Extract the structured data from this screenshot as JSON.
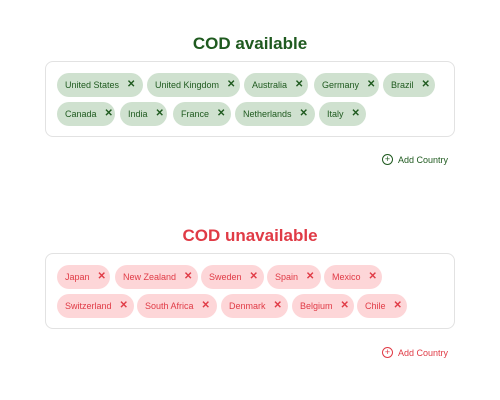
{
  "colors": {
    "available_text": "#1f5a1f",
    "available_chip_bg": "#cfe1cf",
    "unavailable_text": "#e03b46",
    "unavailable_chip_bg": "#fdd6d8"
  },
  "available": {
    "title": "COD available",
    "countries": [
      "United States",
      "United Kingdom",
      "Australia",
      "Germany",
      "Brazil",
      "Canada",
      "India",
      "France",
      "Netherlands",
      "Italy"
    ],
    "add_label": "Add Country",
    "remove_glyph": "✕",
    "add_icon": "plus-circle-icon"
  },
  "unavailable": {
    "title": "COD unavailable",
    "countries": [
      "Japan",
      "New Zealand",
      "Sweden",
      "Spain",
      "Mexico",
      "Switzerland",
      "South Africa",
      "Denmark",
      "Belgium",
      "Chile"
    ],
    "add_label": "Add Country",
    "remove_glyph": "✕",
    "add_icon": "plus-circle-icon"
  }
}
